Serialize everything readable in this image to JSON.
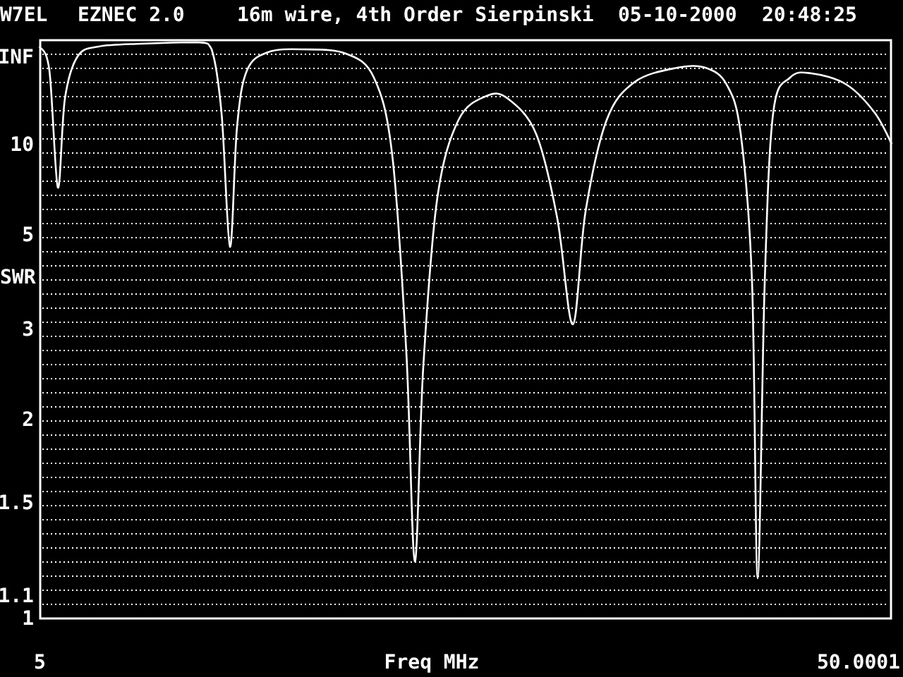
{
  "header": {
    "callsign": "W7EL",
    "program": "EZNEC 2.0",
    "title": "16m wire, 4th Order Sierpinski",
    "date": "05-10-2000",
    "time": "20:48:25"
  },
  "plot": {
    "y_axis_title": "SWR",
    "y_labels": [
      "INF",
      "10",
      "5",
      "3",
      "2",
      "1.5",
      "1.1",
      "1"
    ],
    "x_axis_title": "Freq MHz",
    "x_start_label": "5",
    "x_end_label": "50.0001"
  }
}
